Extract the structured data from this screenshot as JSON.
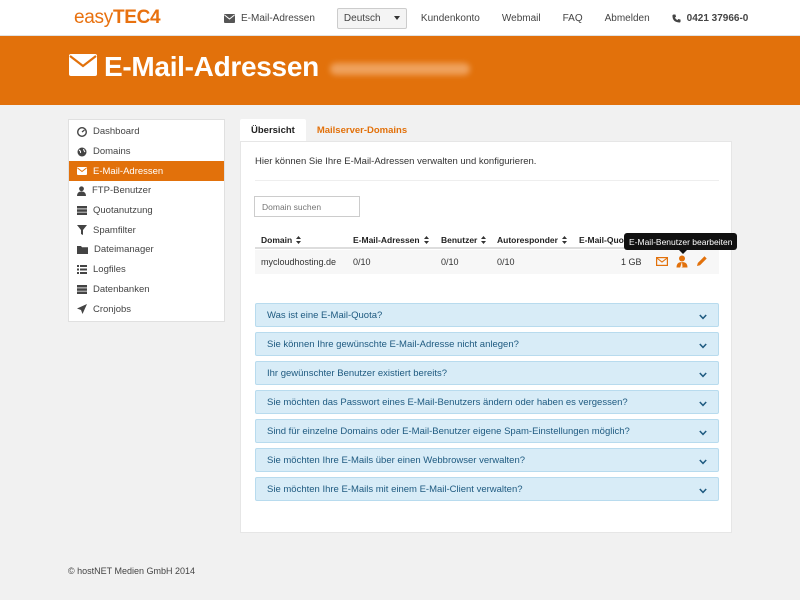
{
  "logo": {
    "text_light": "easy",
    "text_bold": "TEC",
    "text_digit": "4"
  },
  "topnav": {
    "email_label": "E-Mail-Adressen",
    "language": "Deutsch",
    "account": "Kundenkonto",
    "webmail": "Webmail",
    "faq": "FAQ",
    "logout": "Abmelden",
    "phone": "0421 37966-0"
  },
  "banner": {
    "title": "E-Mail-Adressen"
  },
  "sidebar": {
    "items": [
      {
        "label": "Dashboard",
        "icon": "dashboard-icon"
      },
      {
        "label": "Domains",
        "icon": "globe-icon"
      },
      {
        "label": "E-Mail-Adressen",
        "icon": "envelope-icon"
      },
      {
        "label": "FTP-Benutzer",
        "icon": "user-icon"
      },
      {
        "label": "Quotanutzung",
        "icon": "hdd-icon"
      },
      {
        "label": "Spamfilter",
        "icon": "filter-icon"
      },
      {
        "label": "Dateimanager",
        "icon": "folder-icon"
      },
      {
        "label": "Logfiles",
        "icon": "list-icon"
      },
      {
        "label": "Datenbanken",
        "icon": "database-icon"
      },
      {
        "label": "Cronjobs",
        "icon": "send-icon"
      }
    ],
    "active_index": 2
  },
  "tabs": [
    "Übersicht",
    "Mailserver-Domains"
  ],
  "main": {
    "intro": "Hier können Sie Ihre E-Mail-Adressen verwalten und konfigurieren.",
    "search_placeholder": "Domain suchen",
    "table": {
      "headers": [
        "Domain",
        "E-Mail-Adressen",
        "Benutzer",
        "Autoresponder",
        "E-Mail-Quo"
      ],
      "rows": [
        {
          "domain": "mycloudhosting.de",
          "emails": "0/10",
          "users": "0/10",
          "autoresponder": "0/10",
          "quota": "1 GB"
        }
      ]
    },
    "tooltip": "E-Mail-Benutzer bearbeiten"
  },
  "faq": [
    "Was ist eine E-Mail-Quota?",
    "Sie können Ihre gewünschte E-Mail-Adresse nicht anlegen?",
    "Ihr gewünschter Benutzer existiert bereits?",
    "Sie möchten das Passwort eines E-Mail-Benutzers ändern oder haben es vergessen?",
    "Sind für einzelne Domains oder E-Mail-Benutzer eigene Spam-Einstellungen möglich?",
    "Sie möchten Ihre E-Mails über einen Webbrowser verwalten?",
    "Sie möchten Ihre E-Mails mit einem E-Mail-Client verwalten?"
  ],
  "footer": "© hostNET Medien GmbH 2014",
  "colors": {
    "accent": "#e2710b",
    "faq_bg": "#d8ecf7",
    "faq_text": "#1e5a80"
  }
}
